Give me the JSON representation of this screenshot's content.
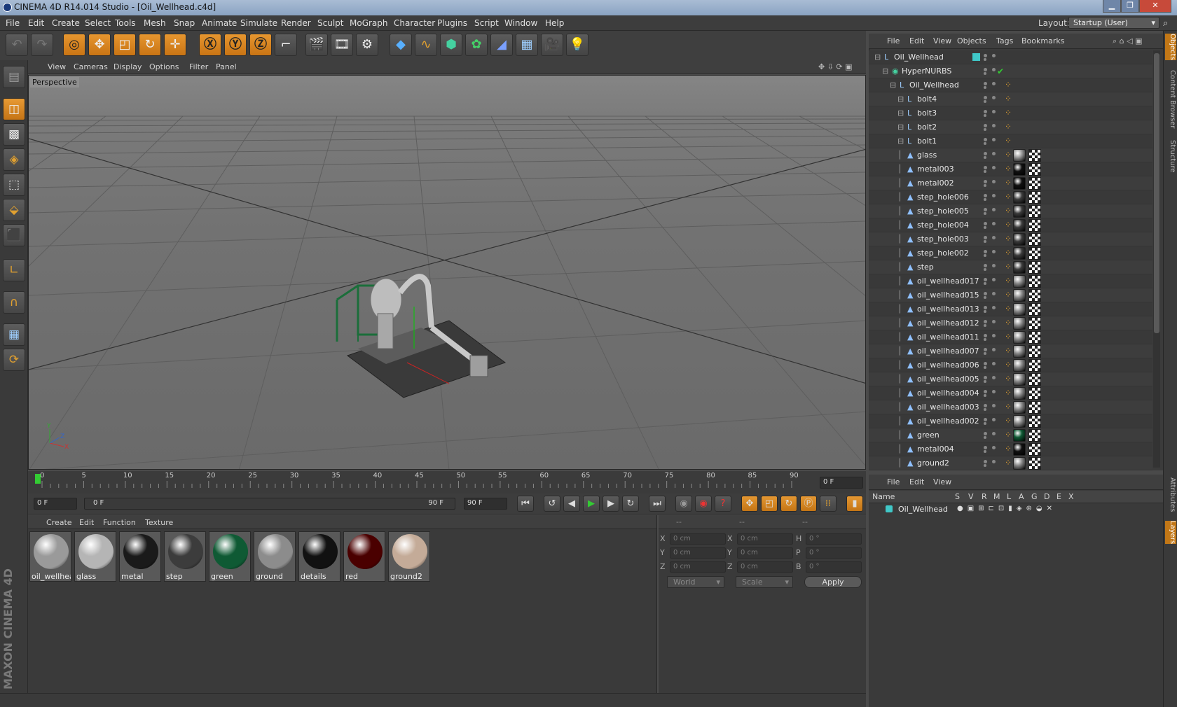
{
  "window": {
    "title": "CINEMA 4D R14.014 Studio - [Oil_Wellhead.c4d]"
  },
  "menu": [
    "File",
    "Edit",
    "Create",
    "Select",
    "Tools",
    "Mesh",
    "Snap",
    "Animate",
    "Simulate",
    "Render",
    "Sculpt",
    "MoGraph",
    "Character",
    "Plugins",
    "Script",
    "Window",
    "Help"
  ],
  "layout": {
    "label": "Layout:",
    "value": "Startup (User)"
  },
  "viewport": {
    "menu": [
      "View",
      "Cameras",
      "Display",
      "Options",
      "Filter",
      "Panel"
    ],
    "camera_label": "Perspective"
  },
  "timeline": {
    "ticks": [
      "0",
      "5",
      "10",
      "15",
      "20",
      "25",
      "30",
      "35",
      "40",
      "45",
      "50",
      "55",
      "60",
      "65",
      "70",
      "75",
      "80",
      "85",
      "90"
    ],
    "current_frame": "0 F"
  },
  "transport": {
    "start_field": "0 F",
    "range_start": "0 F",
    "range_end": "90 F",
    "end_field": "90 F"
  },
  "materials": {
    "menu": [
      "Create",
      "Edit",
      "Function",
      "Texture"
    ],
    "items": [
      {
        "label": "oil_wellhea",
        "color": "#9a9a9a"
      },
      {
        "label": "glass",
        "color": "#b5b5b5"
      },
      {
        "label": "metal",
        "color": "#1a1a1a"
      },
      {
        "label": "step",
        "color": "#3c3c3c"
      },
      {
        "label": "green",
        "color": "#0f5a34"
      },
      {
        "label": "ground",
        "color": "#8c8c8c"
      },
      {
        "label": "details",
        "color": "#111111"
      },
      {
        "label": "red",
        "color": "#4a0000"
      },
      {
        "label": "ground2",
        "color": "#c4ab98"
      }
    ]
  },
  "coords": {
    "headers": [
      "--",
      "--",
      "--"
    ],
    "rows": [
      {
        "a": "X",
        "a_val": "0 cm",
        "b": "X",
        "b_val": "0 cm",
        "c": "H",
        "c_val": "0 °"
      },
      {
        "a": "Y",
        "a_val": "0 cm",
        "b": "Y",
        "b_val": "0 cm",
        "c": "P",
        "c_val": "0 °"
      },
      {
        "a": "Z",
        "a_val": "0 cm",
        "b": "Z",
        "b_val": "0 cm",
        "c": "B",
        "c_val": "0 °"
      }
    ],
    "space": "World",
    "mode": "Scale",
    "apply": "Apply"
  },
  "objects": {
    "menu": [
      "File",
      "Edit",
      "View",
      "Objects",
      "Tags",
      "Bookmarks"
    ],
    "rows": [
      {
        "name": "Oil_Wellhead",
        "indent": 0,
        "type": "null"
      },
      {
        "name": "HyperNURBS",
        "indent": 1,
        "type": "nurbs"
      },
      {
        "name": "Oil_Wellhead",
        "indent": 2,
        "type": "null"
      },
      {
        "name": "bolt4",
        "indent": 3,
        "type": "null"
      },
      {
        "name": "bolt3",
        "indent": 3,
        "type": "null"
      },
      {
        "name": "bolt2",
        "indent": 3,
        "type": "null"
      },
      {
        "name": "bolt1",
        "indent": 3,
        "type": "null"
      },
      {
        "name": "glass",
        "indent": 3,
        "type": "poly",
        "mat": "#9a9a9a"
      },
      {
        "name": "metal003",
        "indent": 3,
        "type": "poly",
        "mat": "#111111"
      },
      {
        "name": "metal002",
        "indent": 3,
        "type": "poly",
        "mat": "#111111"
      },
      {
        "name": "step_hole006",
        "indent": 3,
        "type": "poly",
        "mat": "#3c3c3c"
      },
      {
        "name": "step_hole005",
        "indent": 3,
        "type": "poly",
        "mat": "#3c3c3c"
      },
      {
        "name": "step_hole004",
        "indent": 3,
        "type": "poly",
        "mat": "#3c3c3c"
      },
      {
        "name": "step_hole003",
        "indent": 3,
        "type": "poly",
        "mat": "#3c3c3c"
      },
      {
        "name": "step_hole002",
        "indent": 3,
        "type": "poly",
        "mat": "#3c3c3c"
      },
      {
        "name": "step",
        "indent": 3,
        "type": "poly",
        "mat": "#3c3c3c"
      },
      {
        "name": "oil_wellhead017",
        "indent": 3,
        "type": "poly",
        "mat": "#8a8a8a"
      },
      {
        "name": "oil_wellhead015",
        "indent": 3,
        "type": "poly",
        "mat": "#8a8a8a"
      },
      {
        "name": "oil_wellhead013",
        "indent": 3,
        "type": "poly",
        "mat": "#8a8a8a"
      },
      {
        "name": "oil_wellhead012",
        "indent": 3,
        "type": "poly",
        "mat": "#8a8a8a"
      },
      {
        "name": "oil_wellhead011",
        "indent": 3,
        "type": "poly",
        "mat": "#8a8a8a"
      },
      {
        "name": "oil_wellhead007",
        "indent": 3,
        "type": "poly",
        "mat": "#8a8a8a"
      },
      {
        "name": "oil_wellhead006",
        "indent": 3,
        "type": "poly",
        "mat": "#8a8a8a"
      },
      {
        "name": "oil_wellhead005",
        "indent": 3,
        "type": "poly",
        "mat": "#8a8a8a"
      },
      {
        "name": "oil_wellhead004",
        "indent": 3,
        "type": "poly",
        "mat": "#8a8a8a"
      },
      {
        "name": "oil_wellhead003",
        "indent": 3,
        "type": "poly",
        "mat": "#8a8a8a"
      },
      {
        "name": "oil_wellhead002",
        "indent": 3,
        "type": "poly",
        "mat": "#8a8a8a"
      },
      {
        "name": "green",
        "indent": 3,
        "type": "poly",
        "mat": "#0f5a34"
      },
      {
        "name": "metal004",
        "indent": 3,
        "type": "poly",
        "mat": "#111111"
      },
      {
        "name": "ground2",
        "indent": 3,
        "type": "poly",
        "mat": "#8a8a8a"
      }
    ]
  },
  "layers": {
    "menu": [
      "File",
      "Edit",
      "View"
    ],
    "columns": [
      "Name",
      "S",
      "V",
      "R",
      "M",
      "L",
      "A",
      "G",
      "D",
      "E",
      "X"
    ],
    "row": "Oil_Wellhead"
  },
  "side_tabs": [
    "Objects",
    "Content Browser",
    "Structure",
    "Attributes",
    "Layers"
  ],
  "brand": "MAXON CINEMA 4D",
  "colors": {
    "accent": "#e08e2b",
    "selected_layer": "#40c8c8"
  }
}
